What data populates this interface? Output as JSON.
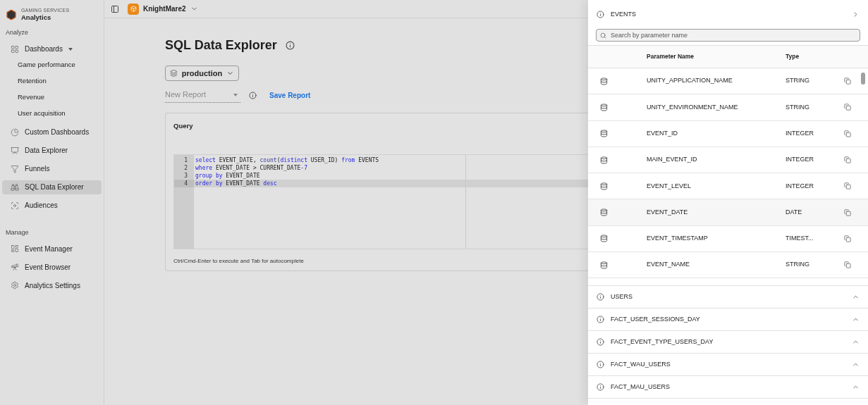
{
  "brand": {
    "subtitle": "GAMING SERVICES",
    "title": "Analytics"
  },
  "sidebar": {
    "sections": [
      {
        "heading": "Analyze",
        "items": [
          {
            "label": "Dashboards",
            "selected": false,
            "expanded": true,
            "children": [
              {
                "label": "Game performance",
                "selected": false
              },
              {
                "label": "Retention",
                "selected": false
              },
              {
                "label": "Revenue",
                "selected": false
              },
              {
                "label": "User acquisition",
                "selected": false
              }
            ]
          },
          {
            "label": "Custom Dashboards",
            "selected": false
          },
          {
            "label": "Data Explorer",
            "selected": false
          },
          {
            "label": "Funnels",
            "selected": false
          },
          {
            "label": "SQL Data Explorer",
            "selected": true
          },
          {
            "label": "Audiences",
            "selected": false
          }
        ]
      },
      {
        "heading": "Manage",
        "items": [
          {
            "label": "Event Manager",
            "selected": false
          },
          {
            "label": "Event Browser",
            "selected": false
          },
          {
            "label": "Analytics Settings",
            "selected": false
          }
        ]
      }
    ]
  },
  "topbar": {
    "project": "KnightMare2"
  },
  "page": {
    "title": "SQL Data Explorer",
    "environment": "production",
    "report": {
      "placeholder": "New Report"
    },
    "save_button": "Save Report"
  },
  "query": {
    "title": "Query",
    "hint": "Ctrl/Cmd-Enter to execute and Tab for autocomplete",
    "lines": [
      {
        "number": "1",
        "selected": false,
        "tokens": [
          {
            "text": "select",
            "kind": "keyword"
          },
          {
            "text": " EVENT_DATE, ",
            "kind": "plain"
          },
          {
            "text": "count",
            "kind": "function"
          },
          {
            "text": "(",
            "kind": "plain"
          },
          {
            "text": "distinct",
            "kind": "keyword"
          },
          {
            "text": " USER_ID) ",
            "kind": "plain"
          },
          {
            "text": "from",
            "kind": "keyword"
          },
          {
            "text": " EVENTS",
            "kind": "plain"
          }
        ]
      },
      {
        "number": "2",
        "selected": false,
        "tokens": [
          {
            "text": "where",
            "kind": "keyword"
          },
          {
            "text": " EVENT_DATE > CURRENT_DATE",
            "kind": "plain"
          },
          {
            "text": "-7",
            "kind": "keyword"
          }
        ]
      },
      {
        "number": "3",
        "selected": false,
        "tokens": [
          {
            "text": "group",
            "kind": "keyword"
          },
          {
            "text": " by",
            "kind": "keyword"
          },
          {
            "text": " EVENT_DATE",
            "kind": "plain"
          }
        ]
      },
      {
        "number": "4",
        "selected": true,
        "tokens": [
          {
            "text": "order",
            "kind": "keyword"
          },
          {
            "text": " by",
            "kind": "keyword"
          },
          {
            "text": " EVENT_DATE ",
            "kind": "plain"
          },
          {
            "text": "desc",
            "kind": "keyword"
          }
        ]
      }
    ]
  },
  "drawer": {
    "tables": [
      {
        "name": "EVENTS",
        "expanded": true,
        "search": {
          "placeholder": "Search by parameter name"
        },
        "columns": [
          "Parameter Name",
          "Type"
        ],
        "rows": [
          {
            "name": "UNITY_APPLICATION_NAME",
            "type": "STRING",
            "selected": false
          },
          {
            "name": "UNITY_ENVIRONMENT_NAME",
            "type": "STRING",
            "selected": false
          },
          {
            "name": "EVENT_ID",
            "type": "INTEGER",
            "selected": false
          },
          {
            "name": "MAIN_EVENT_ID",
            "type": "INTEGER",
            "selected": false
          },
          {
            "name": "EVENT_LEVEL",
            "type": "INTEGER",
            "selected": false
          },
          {
            "name": "EVENT_DATE",
            "type": "DATE",
            "selected": true
          },
          {
            "name": "EVENT_TIMESTAMP",
            "type": "TIMEST...",
            "selected": false
          },
          {
            "name": "EVENT_NAME",
            "type": "STRING",
            "selected": false
          }
        ]
      },
      {
        "name": "USERS",
        "expanded": false
      },
      {
        "name": "FACT_USER_SESSIONS_DAY",
        "expanded": false
      },
      {
        "name": "FACT_EVENT_TYPE_USERS_DAY",
        "expanded": false
      },
      {
        "name": "FACT_WAU_USERS",
        "expanded": false
      },
      {
        "name": "FACT_MAU_USERS",
        "expanded": false
      }
    ]
  }
}
